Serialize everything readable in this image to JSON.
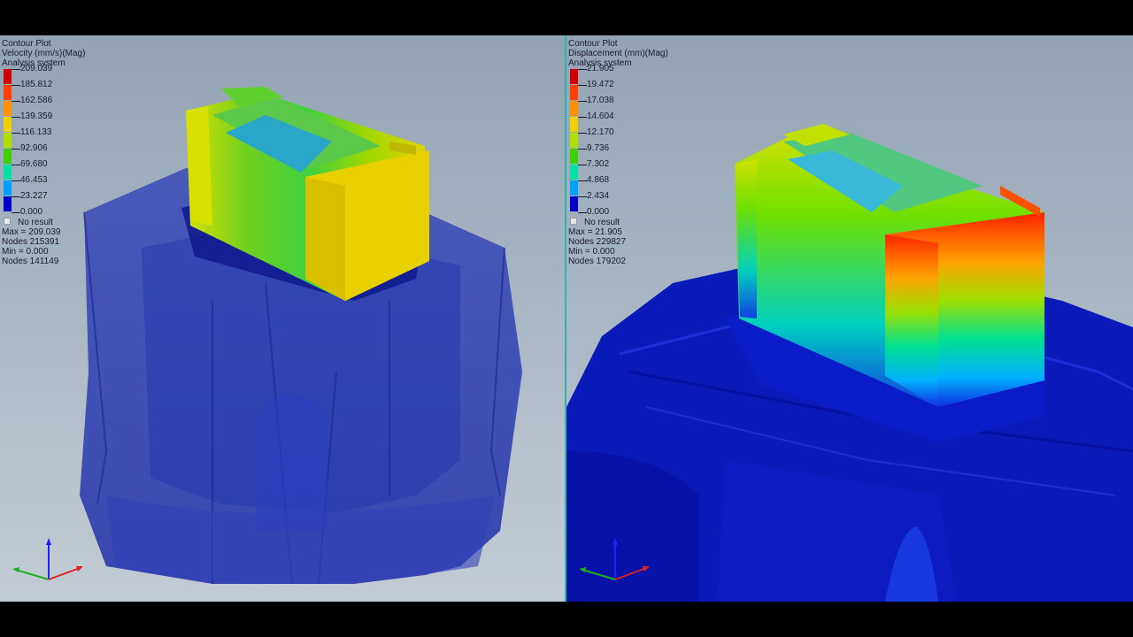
{
  "colors": {
    "scale": [
      "#0000c8",
      "#0050ff",
      "#00a0ff",
      "#00e0e0",
      "#00e070",
      "#40d000",
      "#b0e000",
      "#f0d000",
      "#ff8000",
      "#ff2000",
      "#d00000"
    ]
  },
  "left_panel": {
    "header": [
      "Contour Plot",
      "Velocity (mm/s)(Mag)",
      "Analysis system"
    ],
    "legend_values": [
      "209.039",
      "185.812",
      "162.586",
      "139.359",
      "116.133",
      "92.906",
      "69.680",
      "46.453",
      "23.227",
      "0.000"
    ],
    "no_result": "No result",
    "stats": [
      "Max = 209.039",
      "Nodes 215391",
      "Min = 0.000",
      "Nodes 141149"
    ]
  },
  "right_panel": {
    "header": [
      "Contour Plot",
      "Displacement (mm)(Mag)",
      "Analysis system"
    ],
    "legend_values": [
      "21.905",
      "19.472",
      "17.038",
      "14.604",
      "12.170",
      "9.736",
      "7.302",
      "4.868",
      "2.434",
      "0.000"
    ],
    "no_result": "No result",
    "stats": [
      "Max = 21.905",
      "Nodes 229827",
      "Min = 0.000",
      "Nodes 179202"
    ]
  }
}
